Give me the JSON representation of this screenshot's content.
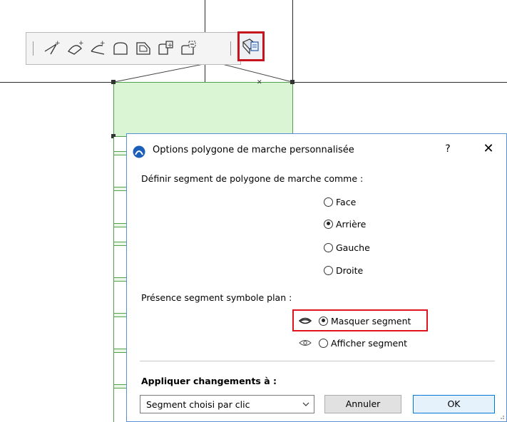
{
  "dialog": {
    "title": "Options polygone de marche personnalisée",
    "help_label": "?",
    "close_label": "✕",
    "define_label": "Définir segment de polygone de marche comme :",
    "segment_options": [
      {
        "label": "Face",
        "checked": false
      },
      {
        "label": "Arrière",
        "checked": true
      },
      {
        "label": "Gauche",
        "checked": false
      },
      {
        "label": "Droite",
        "checked": false
      }
    ],
    "presence_label": "Présence segment symbole plan :",
    "visibility_options": [
      {
        "label": "Masquer segment",
        "checked": true,
        "icon": "eye-closed-icon"
      },
      {
        "label": "Afficher segment",
        "checked": false,
        "icon": "eye-open-icon"
      }
    ],
    "apply_label": "Appliquer changements à :",
    "apply_select_value": "Segment choisi par clic",
    "cancel_label": "Annuler",
    "ok_label": "OK"
  },
  "toolbar": {
    "icons": [
      "polygon-vertex-icon",
      "curved-vertex-icon",
      "arc-vertex-icon",
      "offset-edge-icon",
      "offset-all-edges-icon",
      "add-polygon-icon",
      "subtract-polygon-icon",
      "custom-polygon-options-icon"
    ]
  },
  "colors": {
    "highlight": "#e0141e",
    "stair_fill": "#d9f5d3",
    "dialog_border": "#5a8fd6"
  }
}
